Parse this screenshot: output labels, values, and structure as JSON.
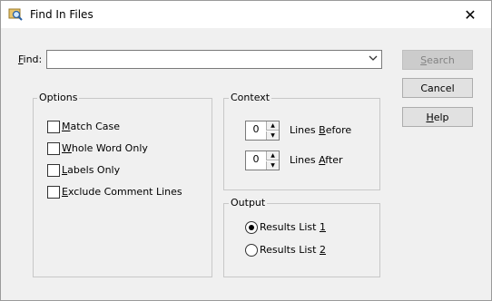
{
  "window": {
    "title": "Find In Files",
    "close_glyph": "✕"
  },
  "find": {
    "label_u": "F",
    "label_rest": "ind:",
    "value": ""
  },
  "buttons": {
    "search": {
      "u": "S",
      "rest": "earch",
      "enabled": false
    },
    "cancel": "Cancel",
    "help": {
      "u": "H",
      "rest": "elp"
    }
  },
  "options": {
    "legend": "Options",
    "items": [
      {
        "u": "M",
        "rest": "atch Case",
        "checked": false
      },
      {
        "u": "W",
        "rest": "hole Word Only",
        "checked": false
      },
      {
        "u": "L",
        "rest": "abels Only",
        "checked": false
      },
      {
        "u": "E",
        "rest": "xclude Comment Lines",
        "checked": false
      }
    ]
  },
  "context": {
    "legend": "Context",
    "before": {
      "value": "0",
      "label_pre": "Lines ",
      "label_u": "B",
      "label_rest": "efore"
    },
    "after": {
      "value": "0",
      "label_pre": "Lines ",
      "label_u": "A",
      "label_rest": "fter"
    }
  },
  "output": {
    "legend": "Output",
    "items": [
      {
        "pre": "Results List ",
        "u": "1",
        "selected": true
      },
      {
        "pre": "Results List ",
        "u": "2",
        "selected": false
      }
    ]
  },
  "icons": {
    "title": "magnifier-folder-icon",
    "dropdown": "chevron-down-icon"
  }
}
